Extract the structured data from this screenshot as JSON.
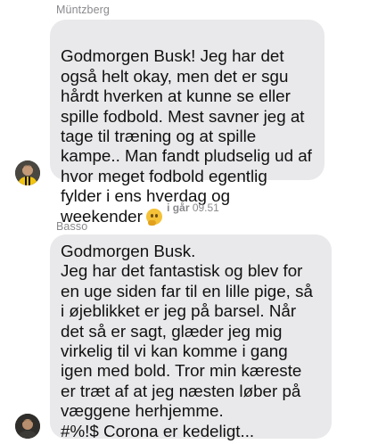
{
  "conversation": {
    "messages": [
      {
        "sender": "Müntzberg",
        "text": "Godmorgen Busk! Jeg har det også helt okay, men det er sgu hårdt hverken at kunne se eller spille fodbold. Mest savner jeg at tage til træning og at spille kampe.. Man fandt pludselig ud af hvor meget fodbold egentlig fylder i ens hverdag og weekender",
        "emoji": "thinking-face"
      },
      {
        "sender": "Basso",
        "text": "Godmorgen Busk.\nJeg har det fantastisk og blev for en uge siden far til en lille pige, så i øjeblikket er jeg på barsel. Når det så er sagt, glæder  jeg mig virkelig til vi kan komme i gang igen med bold. Tror min kæreste er træt af at jeg næsten løber på væggene herhjemme.\n#%!$ Corona er kedeligt..."
      }
    ],
    "timestamp": {
      "day": "i går",
      "time": "09.51"
    }
  }
}
